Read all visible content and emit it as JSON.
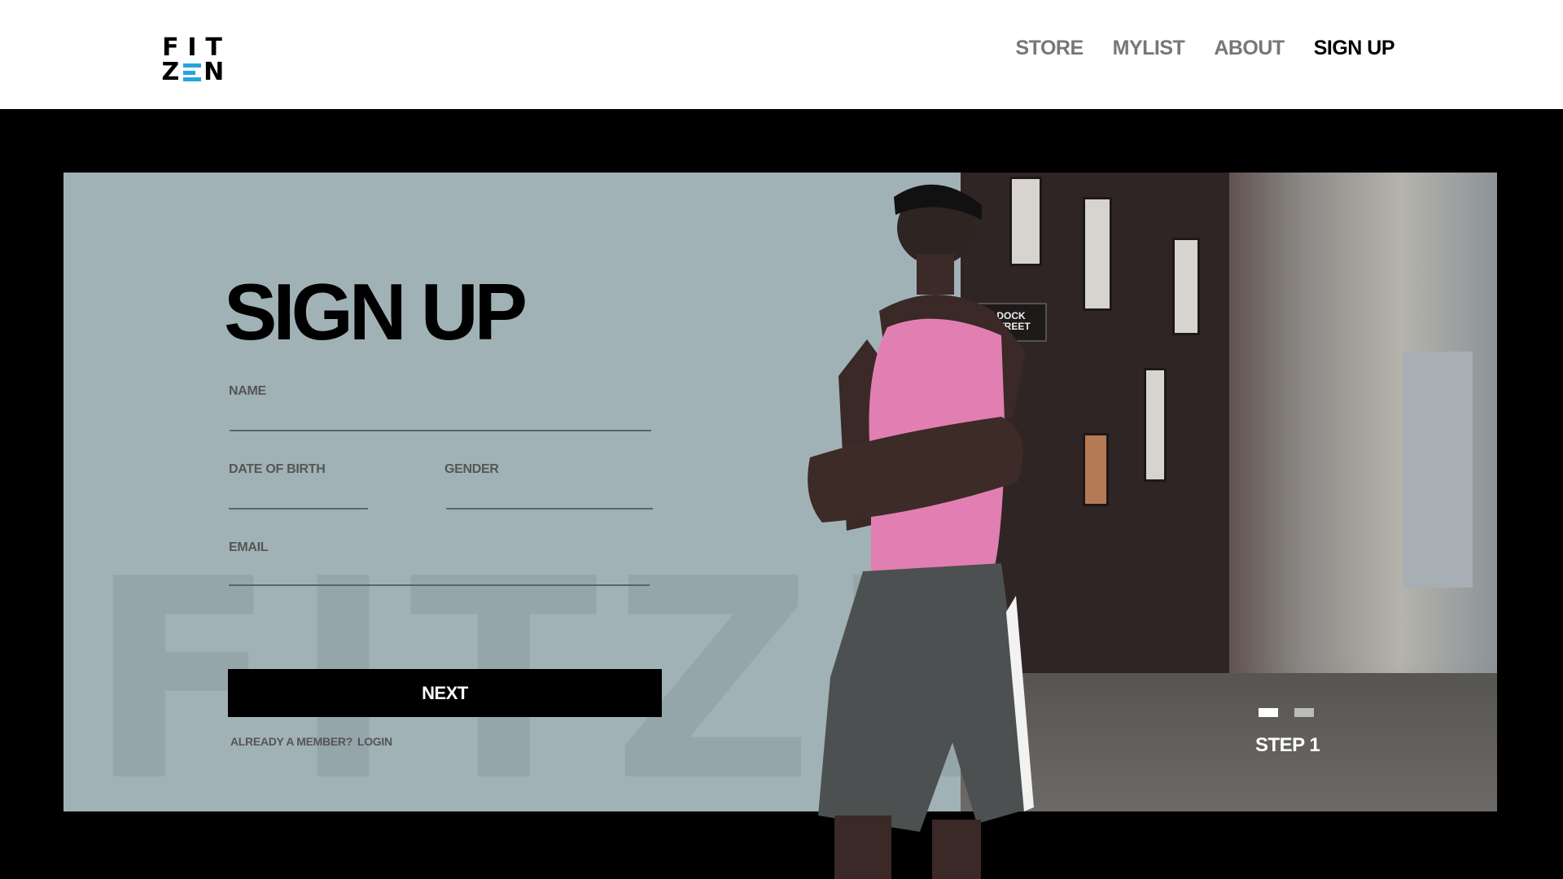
{
  "brand": {
    "line1": [
      "F",
      "I",
      "T"
    ],
    "line2": [
      "Z",
      "N"
    ],
    "accent": "#28a3de"
  },
  "nav": {
    "items": [
      "STORE",
      "MYLIST",
      "ABOUT",
      "SIGN UP"
    ],
    "active": "SIGN UP"
  },
  "form": {
    "title": "SIGN UP",
    "name_label": "NAME",
    "name_value": "",
    "dob_label": "DATE OF BIRTH",
    "dob_value": "",
    "gender_label": "GENDER",
    "gender_value": "",
    "email_label": "EMAIL",
    "email_value": "",
    "next_label": "NEXT",
    "already_text": "ALREADY A MEMBER?",
    "login_text": "LOGIN"
  },
  "watermark": "FITZEN",
  "hero": {
    "sign_text": "DOCK STREET",
    "step_label": "STEP 1",
    "steps_total": 2,
    "current_step": 1
  },
  "colors": {
    "card_bg": "#a1b2b6",
    "page_bg": "#000000",
    "button_bg": "#000000",
    "shirt": "#e27fb2"
  }
}
